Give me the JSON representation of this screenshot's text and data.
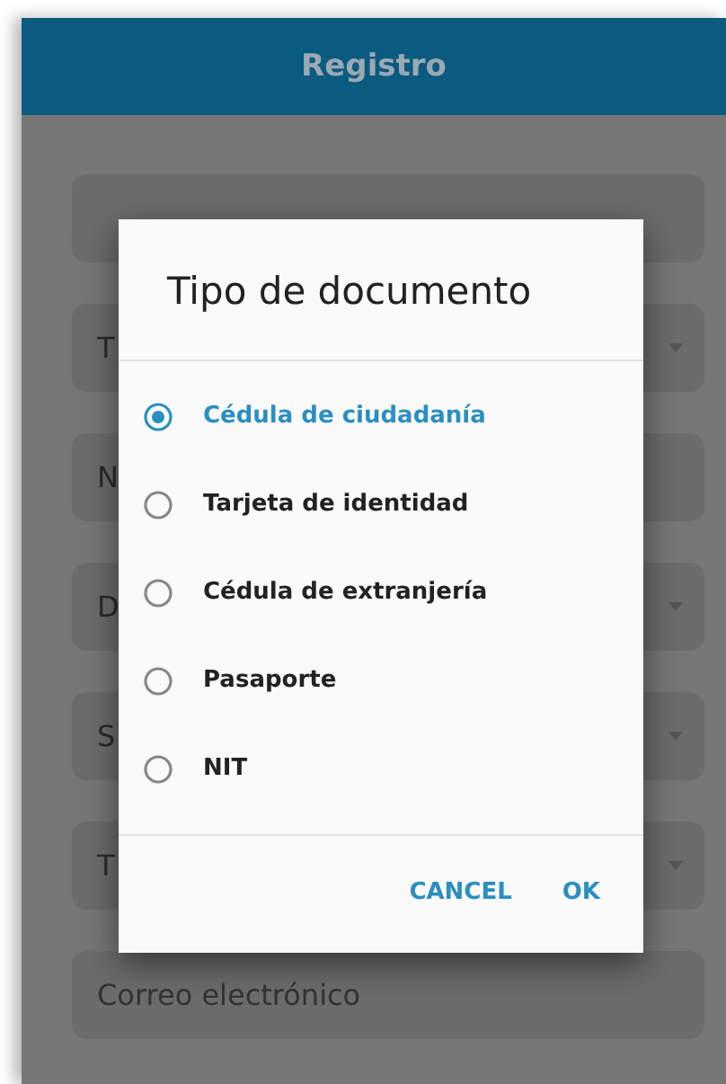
{
  "app_bar": {
    "title": "Registro"
  },
  "form_fields": [
    {
      "kind": "text"
    },
    {
      "kind": "dropdown",
      "text": "T"
    },
    {
      "kind": "text",
      "text": "N"
    },
    {
      "kind": "dropdown",
      "text": "D"
    },
    {
      "kind": "dropdown",
      "text": "S"
    },
    {
      "kind": "dropdown",
      "text": "T"
    },
    {
      "kind": "text",
      "placeholder": "Correo electrónico"
    }
  ],
  "dialog": {
    "title": "Tipo de documento",
    "options": [
      {
        "label": "Cédula de ciudadanía",
        "selected": true
      },
      {
        "label": "Tarjeta de identidad",
        "selected": false
      },
      {
        "label": "Cédula de extranjería",
        "selected": false
      },
      {
        "label": "Pasaporte",
        "selected": false
      },
      {
        "label": "NIT",
        "selected": false
      }
    ],
    "buttons": [
      "CANCEL",
      "OK"
    ]
  }
}
